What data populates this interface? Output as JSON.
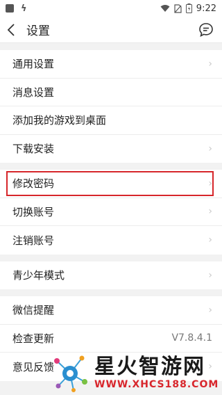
{
  "status_bar": {
    "time": "9:22",
    "icons": [
      "app-square-icon",
      "bolt-icon",
      "wifi-icon",
      "no-sim-icon",
      "battery-icon"
    ]
  },
  "header": {
    "title": "设置",
    "back_icon": "chevron-left-icon",
    "right_icon": "chat-bubble-icon"
  },
  "groups": [
    {
      "items": [
        {
          "label": "通用设置",
          "chevron": true
        },
        {
          "label": "消息设置",
          "chevron": false
        },
        {
          "label": "添加我的游戏到桌面",
          "chevron": false
        },
        {
          "label": "下载安装",
          "chevron": true
        }
      ]
    },
    {
      "items": [
        {
          "label": "修改密码",
          "chevron": true,
          "highlighted": true
        },
        {
          "label": "切换账号",
          "chevron": true
        },
        {
          "label": "注销账号",
          "chevron": true
        }
      ]
    },
    {
      "items": [
        {
          "label": "青少年模式",
          "chevron": true
        }
      ]
    },
    {
      "items": [
        {
          "label": "微信提醒",
          "chevron": true
        },
        {
          "label": "检查更新",
          "value": "V7.8.4.1"
        },
        {
          "label": "意见反馈",
          "chevron": true
        }
      ]
    }
  ],
  "chevron_glyph": "›",
  "watermark": {
    "title": "星火智游网",
    "url": "WWW.XHCS188.COM"
  },
  "colors": {
    "highlight_border": "#d6262a",
    "background": "#f2f2f2",
    "watermark_red": "#d8262c"
  }
}
